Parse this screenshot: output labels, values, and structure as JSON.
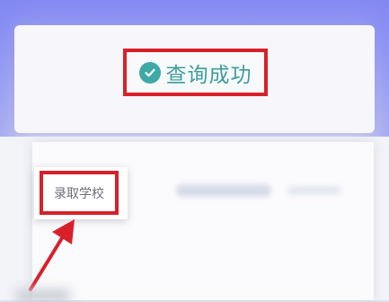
{
  "result": {
    "status_text": "查询成功",
    "icon": "check-circle-icon",
    "status_color": "#3c9e9b"
  },
  "field": {
    "label": "录取学校"
  },
  "annotation": {
    "highlight_color": "#d9202a",
    "arrow_icon": "arrow-up-right-icon"
  },
  "theme": {
    "frame_color": "#8b92f3"
  }
}
